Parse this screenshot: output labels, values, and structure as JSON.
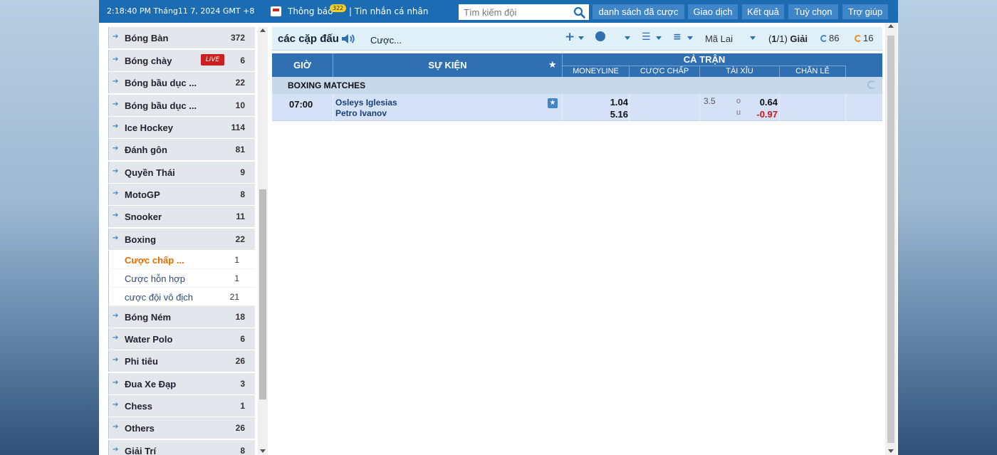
{
  "topbar": {
    "clock": "2:18:40 PM Tháng11 7, 2024 GMT +8",
    "notifications_label": "Thông báo",
    "notifications_count": "322",
    "messages_label": "| Tin nhắn cá nhân",
    "search_placeholder": "Tìm kiếm đội",
    "nav": [
      "danh sách đã cược",
      "Giao dịch",
      "Kết quả",
      "Tuỳ chọn",
      "Trợ giúp"
    ],
    "colors": {
      "bar": "#1c6cb3",
      "button": "#3f86c8"
    }
  },
  "sidebar": {
    "items": [
      {
        "label": "Bóng Bàn",
        "count": "372"
      },
      {
        "label": "Bóng chày",
        "count": "6",
        "badge": "LIVE"
      },
      {
        "label": "Bóng bầu dục ...",
        "count": "22"
      },
      {
        "label": "Bóng bầu dục ...",
        "count": "10"
      },
      {
        "label": "Ice Hockey",
        "count": "114"
      },
      {
        "label": "Đánh gôn",
        "count": "81"
      },
      {
        "label": "Quyền Thái",
        "count": "9"
      },
      {
        "label": "MotoGP",
        "count": "8"
      },
      {
        "label": "Snooker",
        "count": "11"
      },
      {
        "label": "Boxing",
        "count": "22"
      },
      {
        "label": "Bóng Ném",
        "count": "18"
      },
      {
        "label": "Water Polo",
        "count": "6"
      },
      {
        "label": "Phi tiêu",
        "count": "26"
      },
      {
        "label": "Đua Xe Đạp",
        "count": "3"
      },
      {
        "label": "Chess",
        "count": "1"
      },
      {
        "label": "Others",
        "count": "26"
      },
      {
        "label": "Giải Trí",
        "count": "8"
      }
    ],
    "boxing_sub": [
      {
        "label": "Cược chấp ...",
        "count": "1",
        "active": true
      },
      {
        "label": "Cược hỗn hợp",
        "count": "1"
      },
      {
        "label": "cược đội vô địch",
        "count": "21"
      }
    ],
    "active_color": "#e46b00"
  },
  "main": {
    "title": "các cặp đấu",
    "bet_type": "Cược...",
    "odds_format": "Mã Lai",
    "pager": {
      "open": "(",
      "current": "1",
      "sep": "/",
      "total": "1",
      "close": ")",
      "label": "Giải"
    },
    "counter_blue": "86",
    "counter_orange": "16",
    "table": {
      "col_time": "GIỜ",
      "col_event": "SỰ KIỆN",
      "group_full": "CẢ TRẬN",
      "sub_cols": [
        "MONEYLINE",
        "CƯỢC CHẤP",
        "TÀI XỈU",
        "CHẴN LẺ"
      ]
    },
    "league": "BOXING MATCHES",
    "match": {
      "time": "07:00",
      "home": "Osleys Iglesias",
      "away": "Petro Ivanov",
      "ml_home": "1.04",
      "ml_away": "5.16",
      "ou_line": "3.5",
      "over_label": "o",
      "under_label": "u",
      "over_odds": "0.64",
      "under_odds": "-0.97"
    }
  }
}
